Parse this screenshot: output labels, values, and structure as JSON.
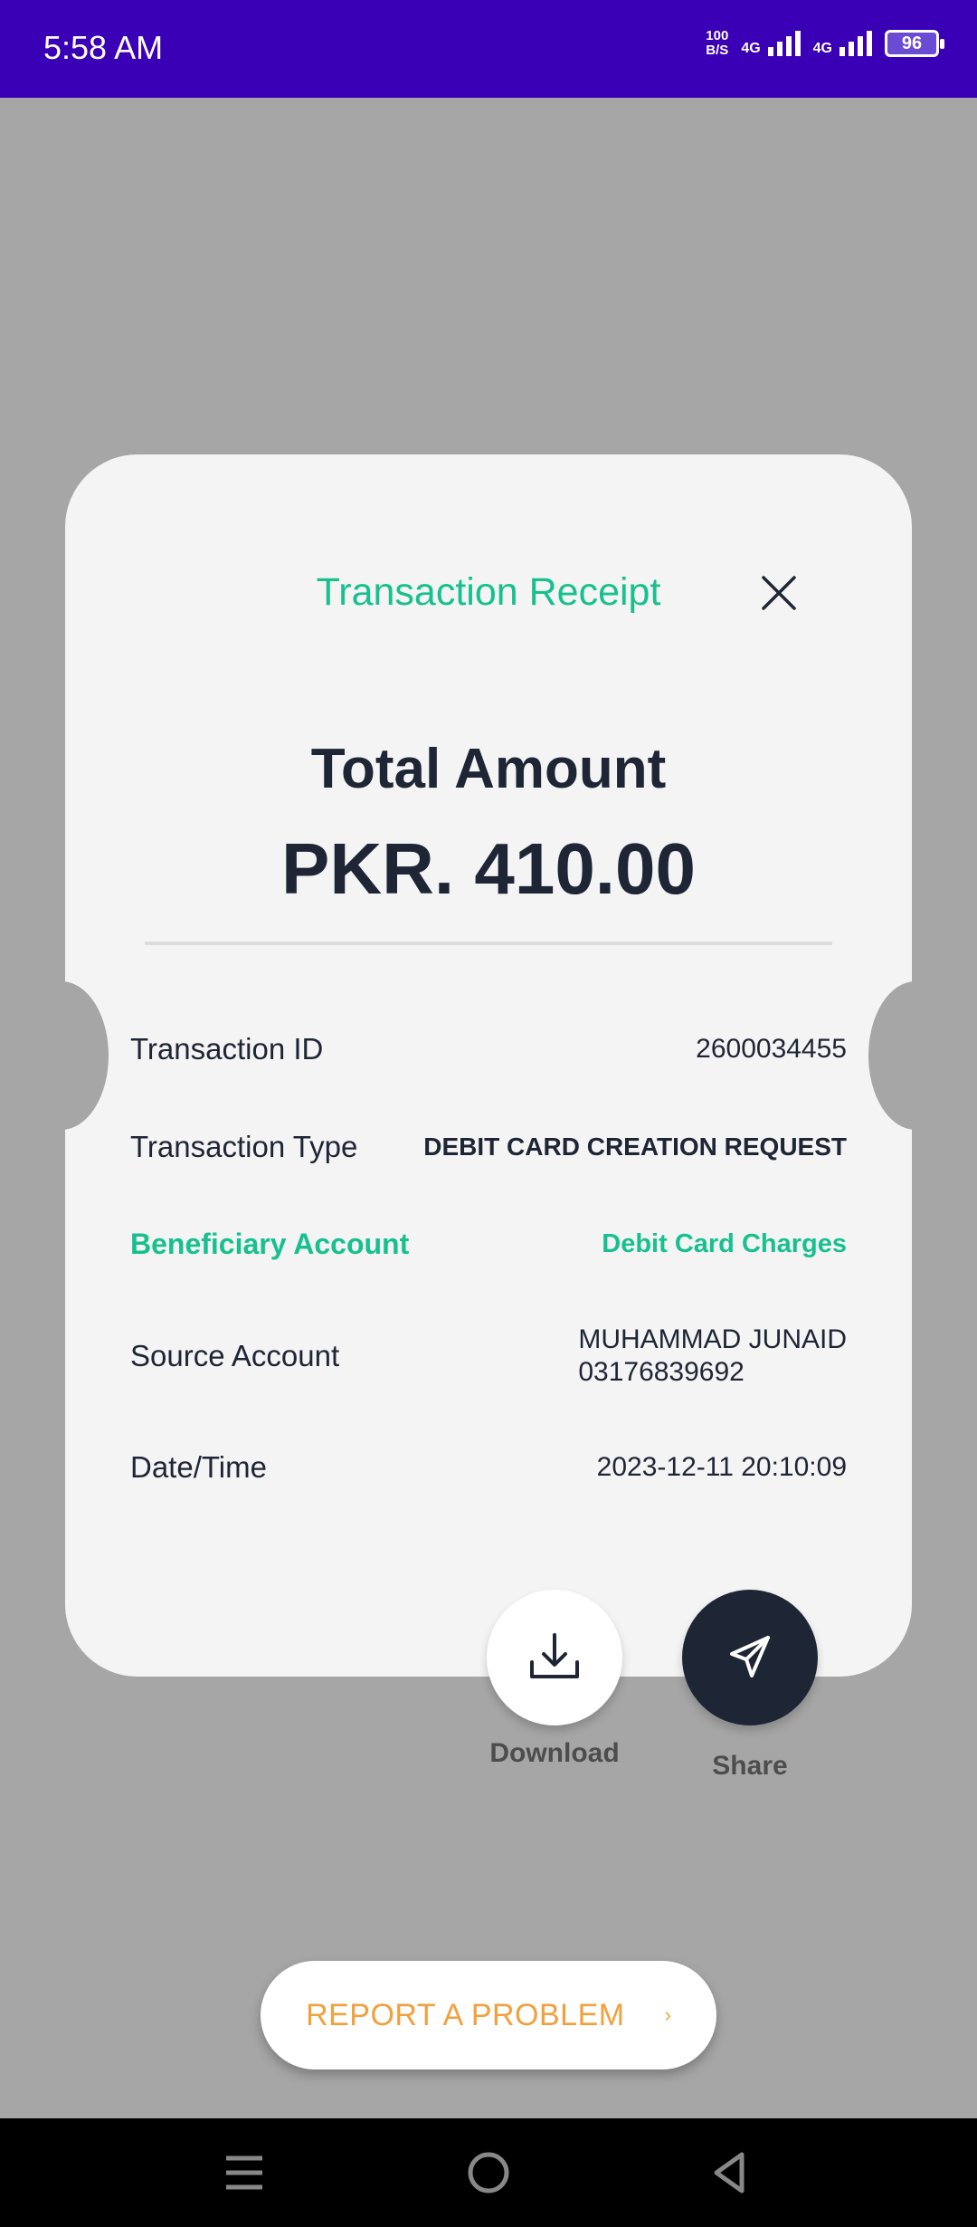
{
  "status_bar": {
    "time": "5:58 AM",
    "net_speed_value": "100",
    "net_speed_unit": "B/S",
    "signal1_label": "4G",
    "signal2_label": "4G",
    "battery": "96"
  },
  "receipt": {
    "title": "Transaction Receipt",
    "total_label": "Total Amount",
    "total_amount": "PKR. 410.00",
    "rows": {
      "transaction_id": {
        "label": "Transaction ID",
        "value": "2600034455"
      },
      "transaction_type": {
        "label": "Transaction Type",
        "value": "DEBIT CARD CREATION REQUEST"
      },
      "beneficiary": {
        "label": "Beneficiary Account",
        "value": "Debit Card Charges"
      },
      "source_account": {
        "label": "Source Account",
        "value_line1": "MUHAMMAD JUNAID",
        "value_line2": "03176839692"
      },
      "date_time": {
        "label": "Date/Time",
        "value": "2023-12-11 20:10:09"
      }
    }
  },
  "actions": {
    "download_label": "Download",
    "share_label": "Share"
  },
  "report": {
    "label": "REPORT A PROBLEM",
    "chevron": "›"
  },
  "colors": {
    "accent_green": "#19c08f",
    "status_bar": "#3a00b5",
    "dark": "#1e2535",
    "report_orange": "#f2a03d"
  },
  "icons": [
    "close-icon",
    "download-icon",
    "send-icon",
    "chevron-right-icon",
    "menu-icon",
    "home-icon",
    "back-icon"
  ]
}
